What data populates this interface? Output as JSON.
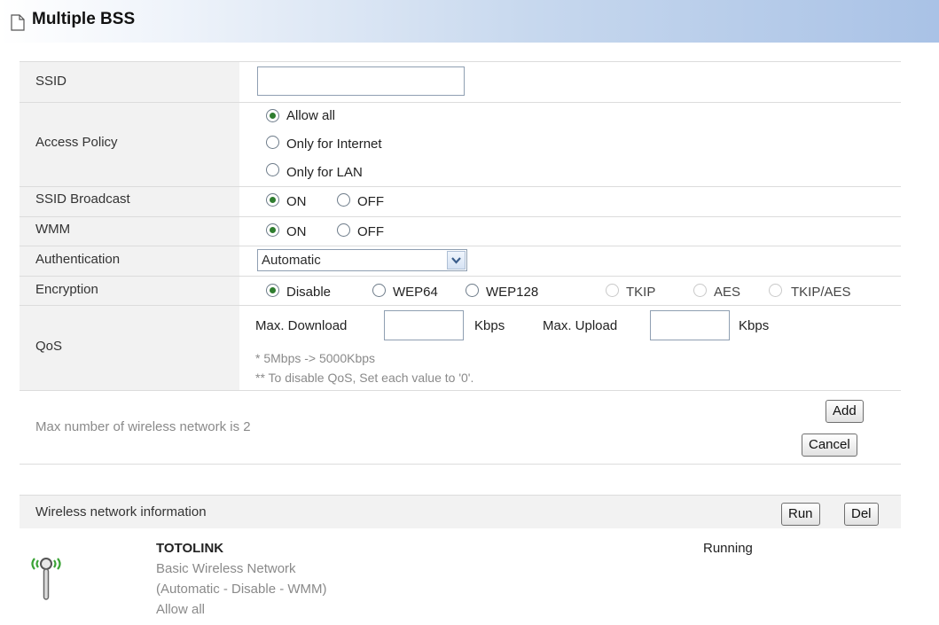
{
  "header": {
    "title": "Multiple BSS",
    "icon": "document-icon"
  },
  "form": {
    "ssid": {
      "label": "SSID",
      "value": ""
    },
    "access_policy": {
      "label": "Access Policy",
      "options": [
        "Allow all",
        "Only for Internet",
        "Only for LAN"
      ],
      "selected": "Allow all"
    },
    "ssid_broadcast": {
      "label": "SSID Broadcast",
      "on": "ON",
      "off": "OFF",
      "selected": "ON"
    },
    "wmm": {
      "label": "WMM",
      "on": "ON",
      "off": "OFF",
      "selected": "ON"
    },
    "authentication": {
      "label": "Authentication",
      "value": "Automatic"
    },
    "encryption": {
      "label": "Encryption",
      "options": [
        "Disable",
        "WEP64",
        "WEP128",
        "TKIP",
        "AES",
        "TKIP/AES"
      ],
      "selected": "Disable",
      "disabled_options": [
        "TKIP",
        "AES",
        "TKIP/AES"
      ]
    },
    "qos": {
      "label": "QoS",
      "max_download_label": "Max. Download",
      "max_download_value": "",
      "download_unit": "Kbps",
      "max_upload_label": "Max. Upload",
      "max_upload_value": "",
      "upload_unit": "Kbps",
      "hint1": "* 5Mbps -> 5000Kbps",
      "hint2": "** To disable QoS, Set each value to '0'."
    }
  },
  "actions": {
    "max_note": "Max number of wireless network is 2",
    "add": "Add",
    "cancel": "Cancel"
  },
  "info": {
    "title": "Wireless network information",
    "run": "Run",
    "del": "Del",
    "network": {
      "icon": "wireless-antenna-icon",
      "name": "TOTOLINK",
      "line1": "Basic Wireless Network",
      "line2": "(Automatic - Disable - WMM)",
      "line3": "Allow all",
      "status": "Running"
    }
  },
  "colors": {
    "header_gradient_end": "#a9c2e6",
    "row_bg": "#f2f2f2",
    "radio_dot": "#2f7d2f",
    "antenna_waves": "#3aa335"
  }
}
